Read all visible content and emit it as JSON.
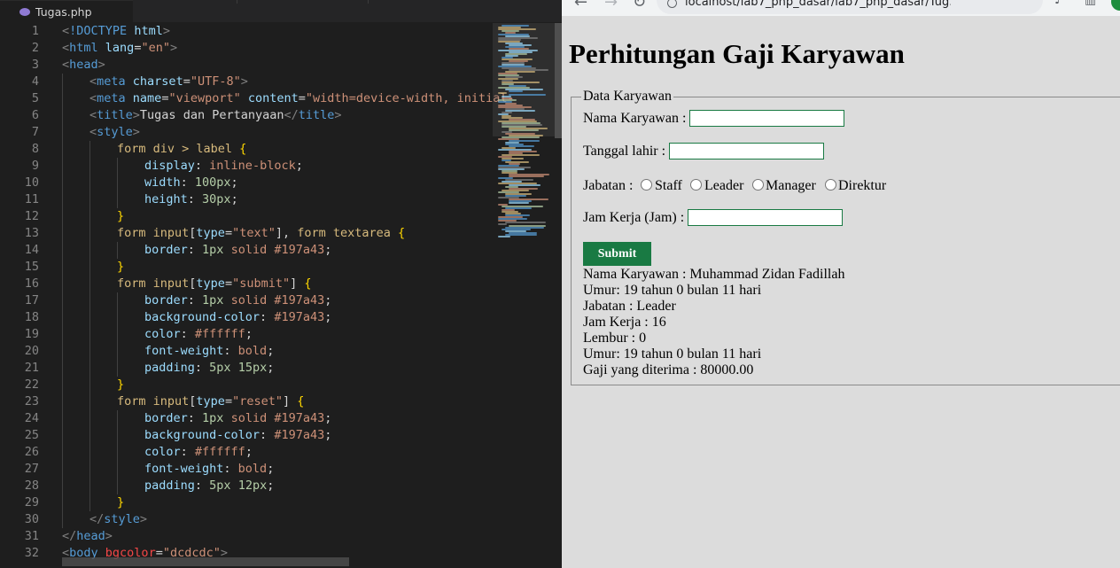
{
  "editor": {
    "tab_label": "Tugas.php",
    "lines": [
      {
        "n": "1",
        "indent": 0,
        "tokens": [
          [
            "t-punc",
            "<"
          ],
          [
            "t-tag",
            "!DOCTYPE"
          ],
          [
            "t-text",
            " "
          ],
          [
            "t-attr",
            "html"
          ],
          [
            "t-punc",
            ">"
          ]
        ]
      },
      {
        "n": "2",
        "indent": 0,
        "tokens": [
          [
            "t-punc",
            "<"
          ],
          [
            "t-tag",
            "html"
          ],
          [
            "t-text",
            " "
          ],
          [
            "t-attr",
            "lang"
          ],
          [
            "t-text",
            "="
          ],
          [
            "t-str",
            "\"en\""
          ],
          [
            "t-punc",
            ">"
          ]
        ]
      },
      {
        "n": "3",
        "indent": 0,
        "tokens": [
          [
            "t-punc",
            "<"
          ],
          [
            "t-tag",
            "head"
          ],
          [
            "t-punc",
            ">"
          ]
        ]
      },
      {
        "n": "4",
        "indent": 1,
        "tokens": [
          [
            "t-punc",
            "<"
          ],
          [
            "t-tag",
            "meta"
          ],
          [
            "t-text",
            " "
          ],
          [
            "t-attr",
            "charset"
          ],
          [
            "t-text",
            "="
          ],
          [
            "t-str",
            "\"UTF-8\""
          ],
          [
            "t-punc",
            ">"
          ]
        ]
      },
      {
        "n": "5",
        "indent": 1,
        "tokens": [
          [
            "t-punc",
            "<"
          ],
          [
            "t-tag",
            "meta"
          ],
          [
            "t-text",
            " "
          ],
          [
            "t-attr",
            "name"
          ],
          [
            "t-text",
            "="
          ],
          [
            "t-str",
            "\"viewport\""
          ],
          [
            "t-text",
            " "
          ],
          [
            "t-attr",
            "content"
          ],
          [
            "t-text",
            "="
          ],
          [
            "t-str",
            "\"width=device-width, initial-"
          ]
        ]
      },
      {
        "n": "6",
        "indent": 1,
        "tokens": [
          [
            "t-punc",
            "<"
          ],
          [
            "t-tag",
            "title"
          ],
          [
            "t-punc",
            ">"
          ],
          [
            "t-text",
            "Tugas dan Pertanyaan"
          ],
          [
            "t-punc",
            "</"
          ],
          [
            "t-tag",
            "title"
          ],
          [
            "t-punc",
            ">"
          ]
        ]
      },
      {
        "n": "7",
        "indent": 1,
        "tokens": [
          [
            "t-punc",
            "<"
          ],
          [
            "t-tag",
            "style"
          ],
          [
            "t-punc",
            ">"
          ]
        ]
      },
      {
        "n": "8",
        "indent": 2,
        "tokens": [
          [
            "t-sel",
            "form div > label "
          ],
          [
            "t-brace",
            "{"
          ]
        ]
      },
      {
        "n": "9",
        "indent": 3,
        "tokens": [
          [
            "t-prop",
            "display"
          ],
          [
            "t-text",
            ": "
          ],
          [
            "t-val",
            "inline-block"
          ],
          [
            "t-text",
            ";"
          ]
        ]
      },
      {
        "n": "10",
        "indent": 3,
        "tokens": [
          [
            "t-prop",
            "width"
          ],
          [
            "t-text",
            ": "
          ],
          [
            "t-num",
            "100px"
          ],
          [
            "t-text",
            ";"
          ]
        ]
      },
      {
        "n": "11",
        "indent": 3,
        "tokens": [
          [
            "t-prop",
            "height"
          ],
          [
            "t-text",
            ": "
          ],
          [
            "t-num",
            "30px"
          ],
          [
            "t-text",
            ";"
          ]
        ]
      },
      {
        "n": "12",
        "indent": 2,
        "tokens": [
          [
            "t-brace",
            "}"
          ]
        ]
      },
      {
        "n": "13",
        "indent": 2,
        "tokens": [
          [
            "t-sel",
            "form input"
          ],
          [
            "t-text",
            "["
          ],
          [
            "t-prop",
            "type"
          ],
          [
            "t-text",
            "="
          ],
          [
            "t-str",
            "\"text\""
          ],
          [
            "t-text",
            "], "
          ],
          [
            "t-sel",
            "form textarea "
          ],
          [
            "t-brace",
            "{"
          ]
        ]
      },
      {
        "n": "14",
        "indent": 3,
        "tokens": [
          [
            "t-prop",
            "border"
          ],
          [
            "t-text",
            ": "
          ],
          [
            "t-num",
            "1px"
          ],
          [
            "t-text",
            " "
          ],
          [
            "t-val",
            "solid"
          ],
          [
            "t-text",
            " "
          ],
          [
            "t-val",
            "#197a43"
          ],
          [
            "t-text",
            ";"
          ]
        ]
      },
      {
        "n": "15",
        "indent": 2,
        "tokens": [
          [
            "t-brace",
            "}"
          ]
        ]
      },
      {
        "n": "16",
        "indent": 2,
        "tokens": [
          [
            "t-sel",
            "form input"
          ],
          [
            "t-text",
            "["
          ],
          [
            "t-prop",
            "type"
          ],
          [
            "t-text",
            "="
          ],
          [
            "t-str",
            "\"submit\""
          ],
          [
            "t-text",
            "] "
          ],
          [
            "t-brace",
            "{"
          ]
        ]
      },
      {
        "n": "17",
        "indent": 3,
        "tokens": [
          [
            "t-prop",
            "border"
          ],
          [
            "t-text",
            ": "
          ],
          [
            "t-num",
            "1px"
          ],
          [
            "t-text",
            " "
          ],
          [
            "t-val",
            "solid"
          ],
          [
            "t-text",
            " "
          ],
          [
            "t-val",
            "#197a43"
          ],
          [
            "t-text",
            ";"
          ]
        ]
      },
      {
        "n": "18",
        "indent": 3,
        "tokens": [
          [
            "t-prop",
            "background-color"
          ],
          [
            "t-text",
            ": "
          ],
          [
            "t-val",
            "#197a43"
          ],
          [
            "t-text",
            ";"
          ]
        ]
      },
      {
        "n": "19",
        "indent": 3,
        "tokens": [
          [
            "t-prop",
            "color"
          ],
          [
            "t-text",
            ": "
          ],
          [
            "t-val",
            "#ffffff"
          ],
          [
            "t-text",
            ";"
          ]
        ]
      },
      {
        "n": "20",
        "indent": 3,
        "tokens": [
          [
            "t-prop",
            "font-weight"
          ],
          [
            "t-text",
            ": "
          ],
          [
            "t-val",
            "bold"
          ],
          [
            "t-text",
            ";"
          ]
        ]
      },
      {
        "n": "21",
        "indent": 3,
        "tokens": [
          [
            "t-prop",
            "padding"
          ],
          [
            "t-text",
            ": "
          ],
          [
            "t-num",
            "5px"
          ],
          [
            "t-text",
            " "
          ],
          [
            "t-num",
            "15px"
          ],
          [
            "t-text",
            ";"
          ]
        ]
      },
      {
        "n": "22",
        "indent": 2,
        "tokens": [
          [
            "t-brace",
            "}"
          ]
        ]
      },
      {
        "n": "23",
        "indent": 2,
        "tokens": [
          [
            "t-sel",
            "form input"
          ],
          [
            "t-text",
            "["
          ],
          [
            "t-prop",
            "type"
          ],
          [
            "t-text",
            "="
          ],
          [
            "t-str",
            "\"reset\""
          ],
          [
            "t-text",
            "] "
          ],
          [
            "t-brace",
            "{"
          ]
        ]
      },
      {
        "n": "24",
        "indent": 3,
        "tokens": [
          [
            "t-prop",
            "border"
          ],
          [
            "t-text",
            ": "
          ],
          [
            "t-num",
            "1px"
          ],
          [
            "t-text",
            " "
          ],
          [
            "t-val",
            "solid"
          ],
          [
            "t-text",
            " "
          ],
          [
            "t-val",
            "#197a43"
          ],
          [
            "t-text",
            ";"
          ]
        ]
      },
      {
        "n": "25",
        "indent": 3,
        "tokens": [
          [
            "t-prop",
            "background-color"
          ],
          [
            "t-text",
            ": "
          ],
          [
            "t-val",
            "#197a43"
          ],
          [
            "t-text",
            ";"
          ]
        ]
      },
      {
        "n": "26",
        "indent": 3,
        "tokens": [
          [
            "t-prop",
            "color"
          ],
          [
            "t-text",
            ": "
          ],
          [
            "t-val",
            "#ffffff"
          ],
          [
            "t-text",
            ";"
          ]
        ]
      },
      {
        "n": "27",
        "indent": 3,
        "tokens": [
          [
            "t-prop",
            "font-weight"
          ],
          [
            "t-text",
            ": "
          ],
          [
            "t-val",
            "bold"
          ],
          [
            "t-text",
            ";"
          ]
        ]
      },
      {
        "n": "28",
        "indent": 3,
        "tokens": [
          [
            "t-prop",
            "padding"
          ],
          [
            "t-text",
            ": "
          ],
          [
            "t-num",
            "5px"
          ],
          [
            "t-text",
            " "
          ],
          [
            "t-num",
            "12px"
          ],
          [
            "t-text",
            ";"
          ]
        ]
      },
      {
        "n": "29",
        "indent": 2,
        "tokens": [
          [
            "t-brace",
            "}"
          ]
        ]
      },
      {
        "n": "30",
        "indent": 1,
        "tokens": [
          [
            "t-punc",
            "</"
          ],
          [
            "t-tag",
            "style"
          ],
          [
            "t-punc",
            ">"
          ]
        ]
      },
      {
        "n": "31",
        "indent": 0,
        "tokens": [
          [
            "t-punc",
            "</"
          ],
          [
            "t-tag",
            "head"
          ],
          [
            "t-punc",
            ">"
          ]
        ]
      },
      {
        "n": "32",
        "indent": 0,
        "tokens": [
          [
            "t-punc",
            "<"
          ],
          [
            "t-tag",
            "body"
          ],
          [
            "t-text",
            " "
          ],
          [
            "t-red",
            "bgcolor"
          ],
          [
            "t-text",
            "="
          ],
          [
            "t-str",
            "\"dcdcdc\""
          ],
          [
            "t-punc",
            ">"
          ]
        ]
      }
    ]
  },
  "browser": {
    "url": "localhost/lab7_php_dasar/lab7_php_dasar/Tug...",
    "page": {
      "title": "Perhitungan Gaji Karyawan",
      "legend": "Data Karyawan",
      "nama_label": "Nama Karyawan :",
      "nama_value": "",
      "tanggal_label": "Tanggal lahir :",
      "tanggal_value": "",
      "jabatan_label": "Jabatan :",
      "jabatan_options": [
        "Staff",
        "Leader",
        "Manager",
        "Direktur"
      ],
      "jam_label": "Jam Kerja (Jam) :",
      "jam_value": "",
      "submit_label": "Submit",
      "results": [
        "Nama Karyawan : Muhammad Zidan Fadillah",
        "Umur: 19 tahun 0 bulan 11 hari",
        "Jabatan : Leader",
        "Jam Kerja : 16",
        "Lembur : 0",
        "Umur: 19 tahun 0 bulan 11 hari",
        "Gaji yang diterima : 80000.00"
      ]
    }
  },
  "colors": {
    "editor_bg": "#1e1e1e",
    "page_bg": "#dcdcdc",
    "accent_green": "#197a43"
  }
}
